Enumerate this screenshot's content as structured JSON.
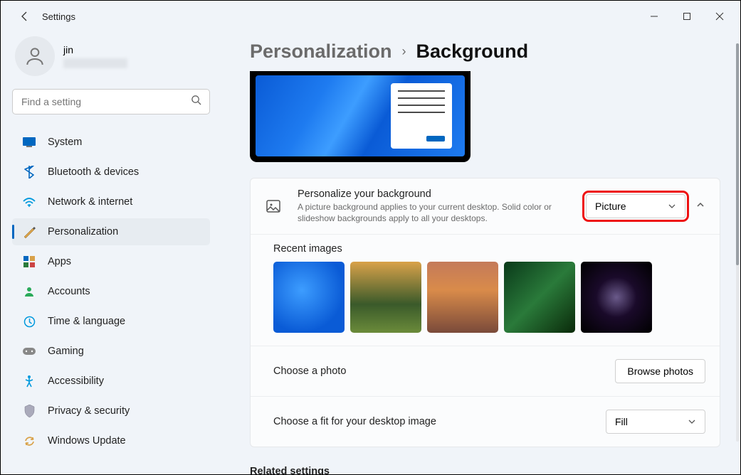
{
  "window": {
    "title": "Settings"
  },
  "profile": {
    "name": "jin"
  },
  "search": {
    "placeholder": "Find a setting"
  },
  "nav": [
    {
      "icon": "system",
      "label": "System"
    },
    {
      "icon": "bluetooth",
      "label": "Bluetooth & devices"
    },
    {
      "icon": "network",
      "label": "Network & internet"
    },
    {
      "icon": "personalization",
      "label": "Personalization",
      "active": true
    },
    {
      "icon": "apps",
      "label": "Apps"
    },
    {
      "icon": "accounts",
      "label": "Accounts"
    },
    {
      "icon": "time",
      "label": "Time & language"
    },
    {
      "icon": "gaming",
      "label": "Gaming"
    },
    {
      "icon": "accessibility",
      "label": "Accessibility"
    },
    {
      "icon": "privacy",
      "label": "Privacy & security"
    },
    {
      "icon": "update",
      "label": "Windows Update"
    }
  ],
  "breadcrumb": {
    "parent": "Personalization",
    "current": "Background"
  },
  "personalize": {
    "title": "Personalize your background",
    "subtitle": "A picture background applies to your current desktop. Solid color or slideshow backgrounds apply to all your desktops.",
    "dropdown_value": "Picture"
  },
  "recent": {
    "title": "Recent images"
  },
  "choose_photo": {
    "label": "Choose a photo",
    "button": "Browse photos"
  },
  "choose_fit": {
    "label": "Choose a fit for your desktop image",
    "value": "Fill"
  },
  "related": {
    "title": "Related settings"
  }
}
